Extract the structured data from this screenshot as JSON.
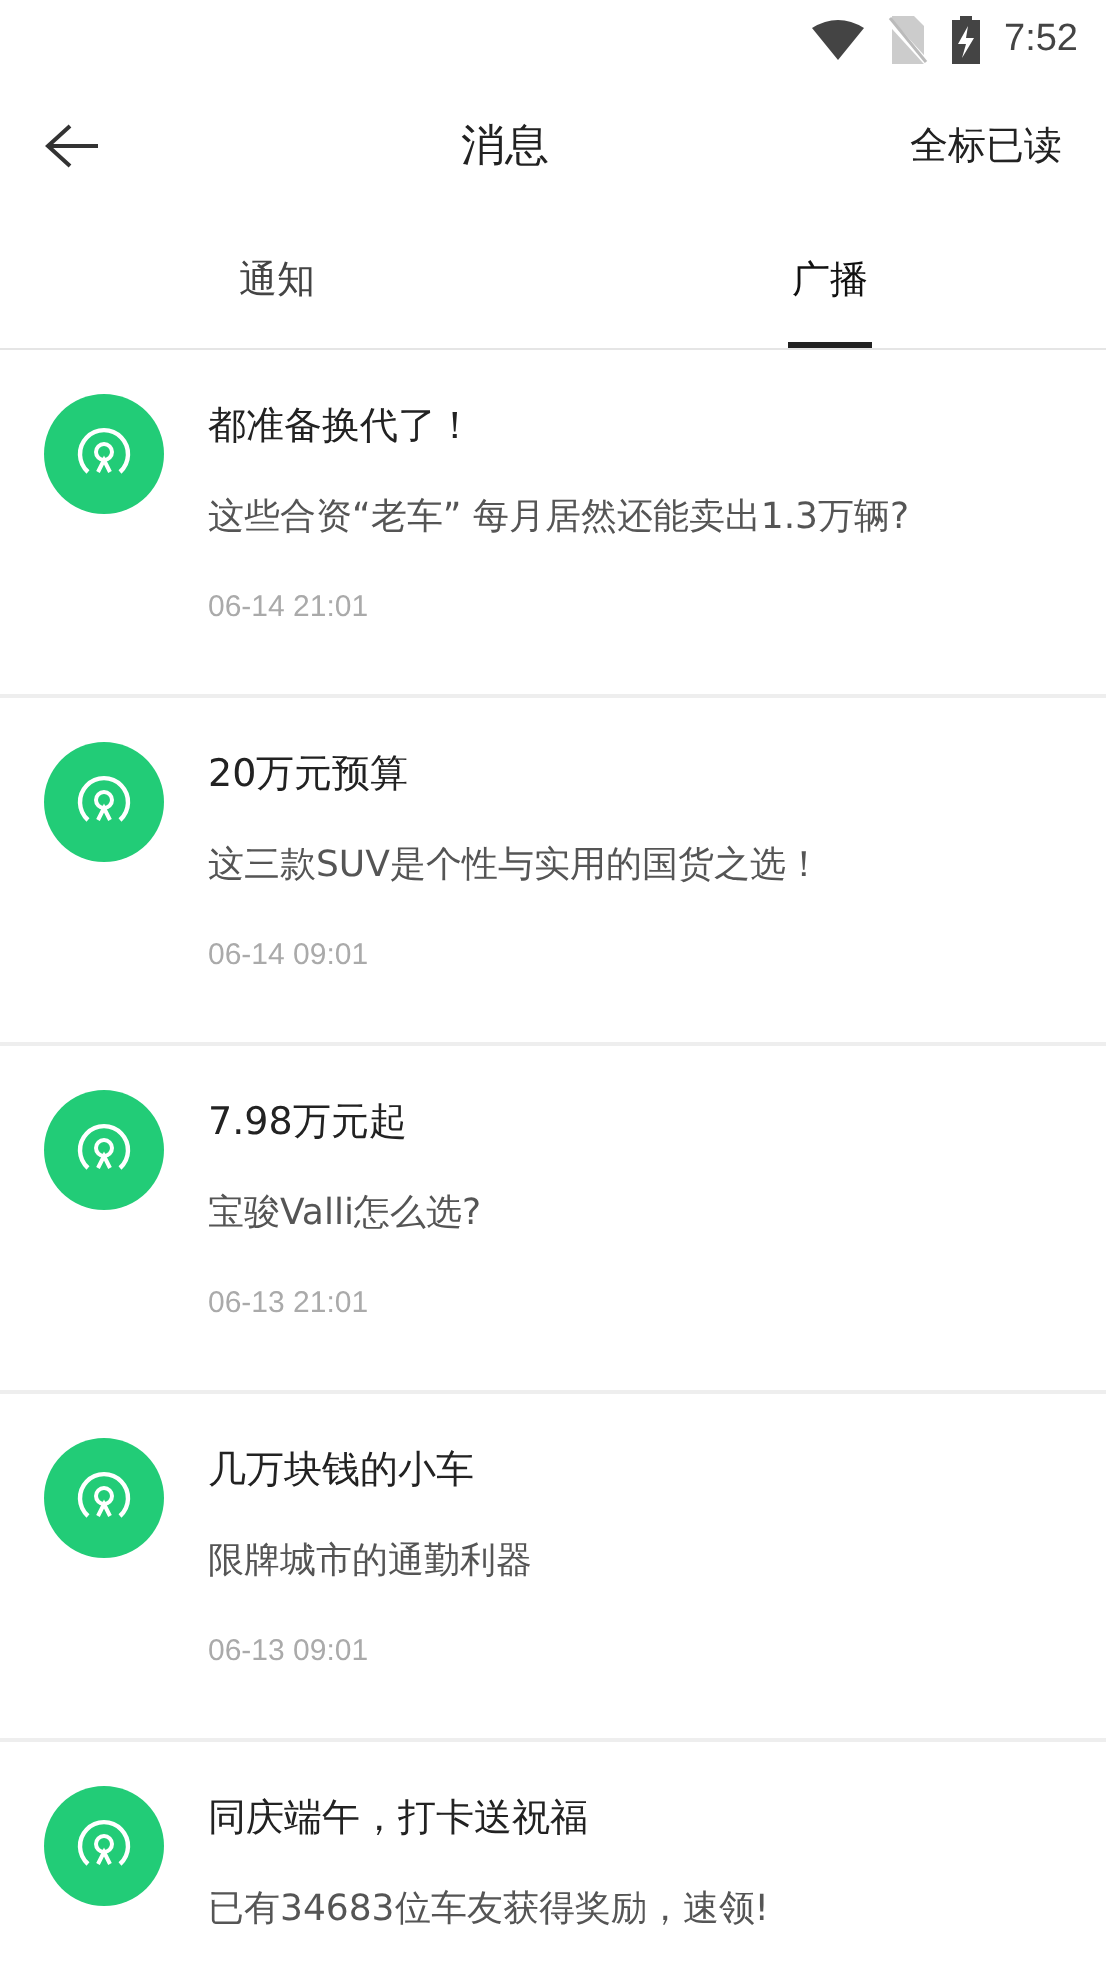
{
  "status_bar": {
    "time": "7:52"
  },
  "header": {
    "title": "消息",
    "action": "全标已读"
  },
  "tabs": [
    {
      "label": "通知",
      "selected": false
    },
    {
      "label": "广播",
      "selected": true
    }
  ],
  "messages": [
    {
      "title": "都准备换代了！",
      "summary": "这些合资“老车” 每月居然还能卖出1.3万辆?",
      "time": "06-14 21:01"
    },
    {
      "title": "20万元预算",
      "summary": "这三款SUV是个性与实用的国货之选！",
      "time": "06-14 09:01"
    },
    {
      "title": "7.98万元起",
      "summary": "宝骏Valli怎么选?",
      "time": "06-13 21:01"
    },
    {
      "title": "几万块钱的小车",
      "summary": "限牌城市的通勤利器",
      "time": "06-13 09:01"
    },
    {
      "title": "同庆端午，打卡送祝福",
      "summary": "已有34683位车友获得奖励，速领!"
    }
  ]
}
